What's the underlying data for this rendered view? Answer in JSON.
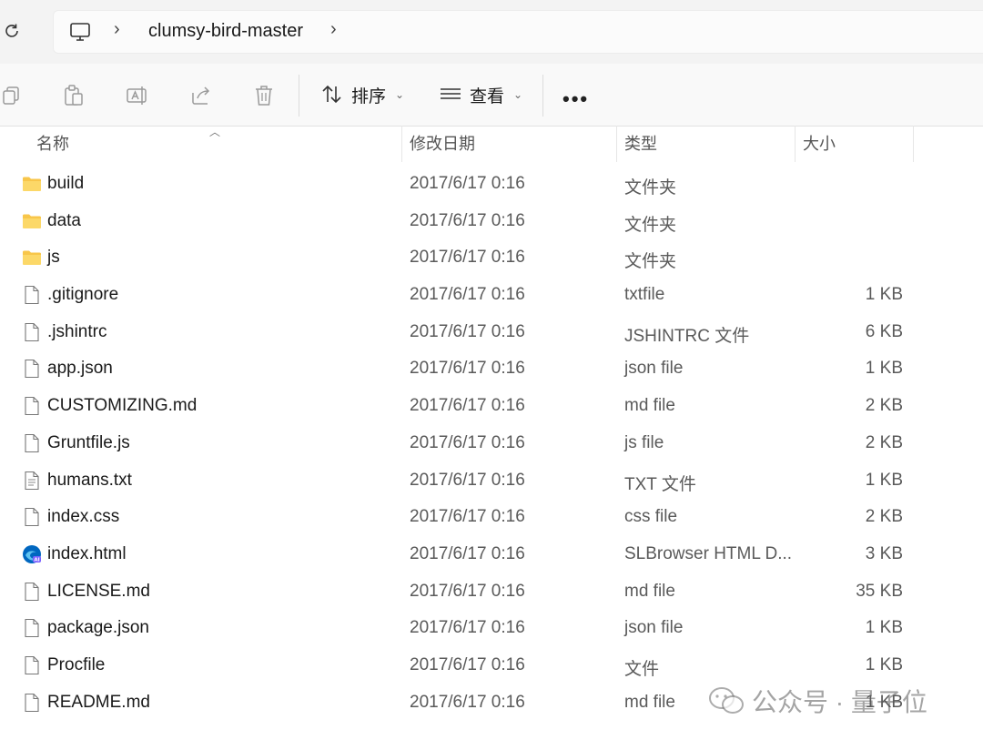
{
  "address": {
    "breadcrumb": "clumsy-bird-master",
    "separator_1": "›",
    "separator_2": "›"
  },
  "toolbar": {
    "sort_label": "排序",
    "view_label": "查看",
    "more_label": "•••",
    "chevron": "⌄"
  },
  "columns": {
    "name": "名称",
    "date": "修改日期",
    "type": "类型",
    "size": "大小"
  },
  "files": [
    {
      "name": "build",
      "date": "2017/6/17 0:16",
      "type": "文件夹",
      "size": "",
      "icon": "folder-icon"
    },
    {
      "name": "data",
      "date": "2017/6/17 0:16",
      "type": "文件夹",
      "size": "",
      "icon": "folder-icon"
    },
    {
      "name": "js",
      "date": "2017/6/17 0:16",
      "type": "文件夹",
      "size": "",
      "icon": "folder-icon"
    },
    {
      "name": ".gitignore",
      "date": "2017/6/17 0:16",
      "type": "txtfile",
      "size": "1 KB",
      "icon": "file-icon"
    },
    {
      "name": ".jshintrc",
      "date": "2017/6/17 0:16",
      "type": "JSHINTRC 文件",
      "size": "6 KB",
      "icon": "file-icon"
    },
    {
      "name": "app.json",
      "date": "2017/6/17 0:16",
      "type": "json file",
      "size": "1 KB",
      "icon": "file-icon"
    },
    {
      "name": "CUSTOMIZING.md",
      "date": "2017/6/17 0:16",
      "type": "md file",
      "size": "2 KB",
      "icon": "file-icon"
    },
    {
      "name": "Gruntfile.js",
      "date": "2017/6/17 0:16",
      "type": "js file",
      "size": "2 KB",
      "icon": "file-icon"
    },
    {
      "name": "humans.txt",
      "date": "2017/6/17 0:16",
      "type": "TXT 文件",
      "size": "1 KB",
      "icon": "text-file-icon"
    },
    {
      "name": "index.css",
      "date": "2017/6/17 0:16",
      "type": "css file",
      "size": "2 KB",
      "icon": "file-icon"
    },
    {
      "name": "index.html",
      "date": "2017/6/17 0:16",
      "type": "SLBrowser HTML D...",
      "size": "3 KB",
      "icon": "browser-icon"
    },
    {
      "name": "LICENSE.md",
      "date": "2017/6/17 0:16",
      "type": "md file",
      "size": "35 KB",
      "icon": "file-icon"
    },
    {
      "name": "package.json",
      "date": "2017/6/17 0:16",
      "type": "json file",
      "size": "1 KB",
      "icon": "file-icon"
    },
    {
      "name": "Procfile",
      "date": "2017/6/17 0:16",
      "type": "文件",
      "size": "1 KB",
      "icon": "file-icon"
    },
    {
      "name": "README.md",
      "date": "2017/6/17 0:16",
      "type": "md file",
      "size": "1 KB",
      "icon": "file-icon"
    }
  ],
  "watermark": {
    "text": "公众号 · 量子位"
  },
  "colors": {
    "folder": "#f8c64a",
    "accent": "#0067c0"
  }
}
